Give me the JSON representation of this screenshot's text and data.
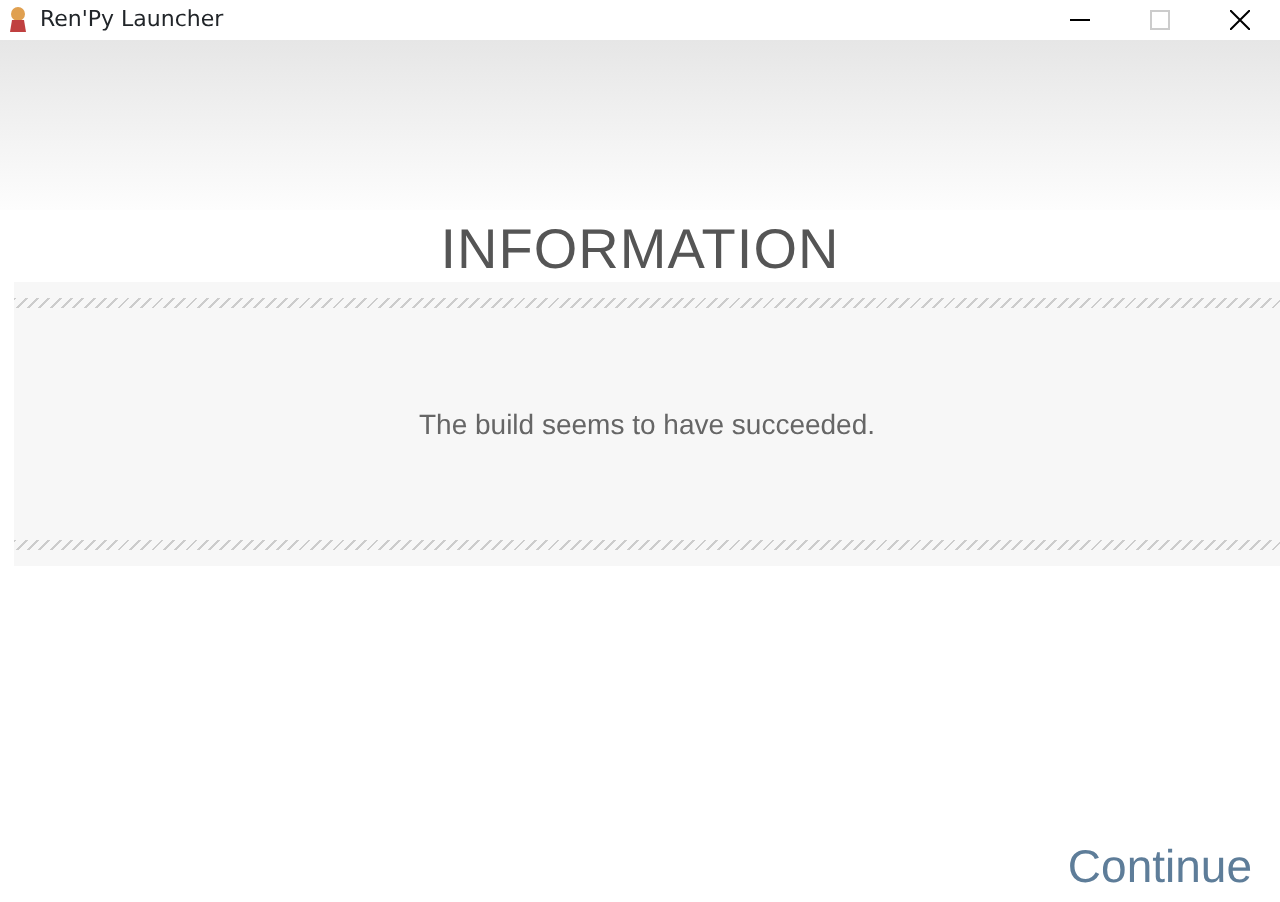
{
  "window": {
    "title": "Ren'Py Launcher"
  },
  "heading": "INFORMATION",
  "message": "The build seems to have succeeded.",
  "buttons": [
    {
      "label": "Continue"
    }
  ]
}
